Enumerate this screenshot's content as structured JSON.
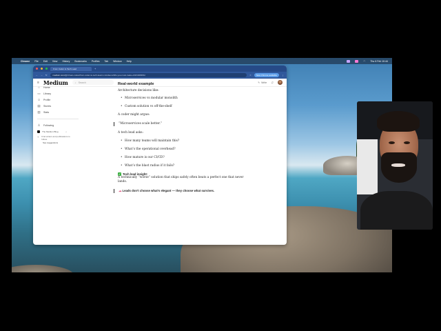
{
  "menubar": {
    "app": "Chrome",
    "items": [
      "File",
      "Edit",
      "View",
      "History",
      "Bookmarks",
      "Profiles",
      "Tab",
      "Window",
      "Help"
    ],
    "clock": "Thu 6 Feb 10:44"
  },
  "browser": {
    "tab_title": "From Coder to Tech Lead",
    "url_domain": "medium.com",
    "url_path": "/@rizwan-codes/from-coder-to-tech-lead-1-mindset-shifts-you-must-make-e61f1b684f9d",
    "new_chrome_label": "New Chrome available"
  },
  "header": {
    "logo": "Medium",
    "search_placeholder": "Search",
    "write_label": "Write"
  },
  "sidebar": {
    "items": [
      {
        "label": "Home",
        "icon": "home-icon"
      },
      {
        "label": "Library",
        "icon": "library-icon"
      },
      {
        "label": "Profile",
        "icon": "profile-icon"
      },
      {
        "label": "Stories",
        "icon": "stories-icon"
      },
      {
        "label": "Stats",
        "icon": "stats-icon"
      }
    ],
    "following_label": "Following",
    "blog_label": "The Medium Blog",
    "find_text": "Find writers and publications to follow.",
    "see_suggestions": "See suggestions"
  },
  "article": {
    "heading": "Real-world example",
    "intro": "Architecture decisions like:",
    "bullets1": [
      "Microservices vs modular monolith",
      "Custom solution vs off-the-shelf"
    ],
    "coder_line": "A coder might argue:",
    "quote": "“Microservices scale better.”",
    "lead_line": "A tech lead asks:",
    "bullets2": [
      "How many teams will maintain this?",
      "What’s the operational overhead?",
      "How mature is our CI/CD?",
      "What’s the blast radius if it fails?"
    ],
    "insight_title": "Tech lead insight:",
    "insight_body": "A technically “worse” solution that ships safely often beats a perfect one that never lands.",
    "final_line": "Leads don’t choose what’s elegant — they choose what survives."
  }
}
